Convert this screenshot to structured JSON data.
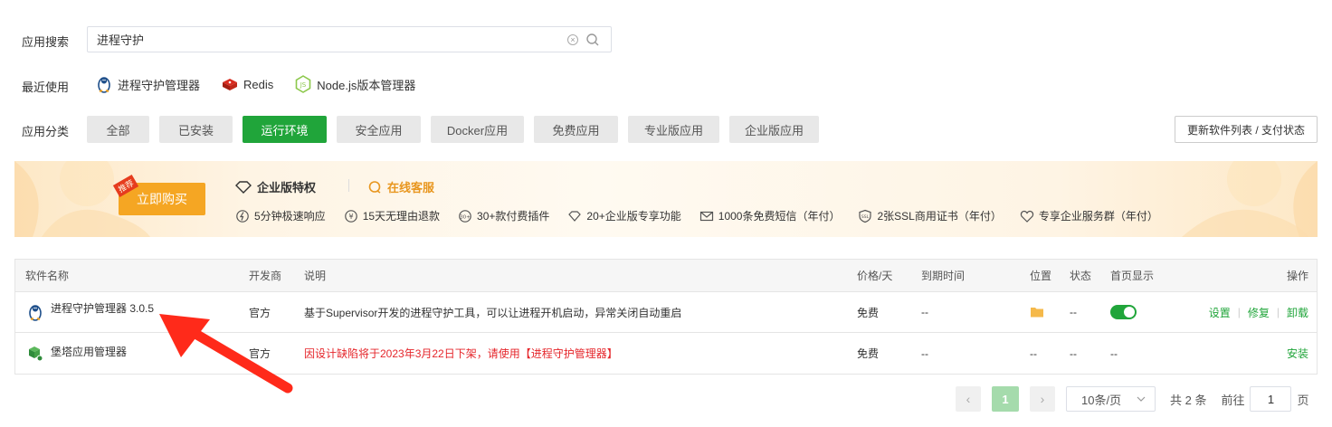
{
  "search": {
    "label": "应用搜索",
    "value": "进程守护"
  },
  "recent": {
    "label": "最近使用",
    "items": [
      {
        "label": "进程守护管理器",
        "icon": "penguin-icon"
      },
      {
        "label": "Redis",
        "icon": "redis-icon"
      },
      {
        "label": "Node.js版本管理器",
        "icon": "nodejs-icon"
      }
    ]
  },
  "categories": {
    "label": "应用分类",
    "items": [
      {
        "label": "全部",
        "active": false
      },
      {
        "label": "已安装",
        "active": false
      },
      {
        "label": "运行环境",
        "active": true
      },
      {
        "label": "安全应用",
        "active": false
      },
      {
        "label": "Docker应用",
        "active": false
      },
      {
        "label": "免费应用",
        "active": false
      },
      {
        "label": "专业版应用",
        "active": false
      },
      {
        "label": "企业版应用",
        "active": false
      }
    ],
    "update_button": "更新软件列表 / 支付状态"
  },
  "banner": {
    "buy_label": "立即购买",
    "buy_tag": "推荐",
    "enterprise_title": "企业版特权",
    "service_title": "在线客服",
    "features": [
      {
        "label": "5分钟极速响应",
        "icon": "lightning-icon"
      },
      {
        "label": "15天无理由退款",
        "icon": "refund-icon"
      },
      {
        "label": "30+款付费插件",
        "icon": "plugin-icon"
      },
      {
        "label": "20+企业版专享功能",
        "icon": "diamond-icon"
      },
      {
        "label": "1000条免费短信（年付）",
        "icon": "mail-icon"
      },
      {
        "label": "2张SSL商用证书（年付）",
        "icon": "ssl-icon"
      },
      {
        "label": "专享企业服务群（年付）",
        "icon": "heart-icon"
      }
    ]
  },
  "table": {
    "headers": {
      "name": "软件名称",
      "developer": "开发商",
      "desc": "说明",
      "price": "价格/天",
      "expire": "到期时间",
      "location": "位置",
      "status": "状态",
      "homepage": "首页显示",
      "actions": "操作"
    },
    "rows": [
      {
        "name": "进程守护管理器 3.0.5",
        "icon": "penguin-icon",
        "developer": "官方",
        "desc": "基于Supervisor开发的进程守护工具，可以让进程开机启动，异常关闭自动重启",
        "price": "免费",
        "expire": "--",
        "status": "--",
        "actions": [
          "设置",
          "修复",
          "卸载"
        ]
      },
      {
        "name": "堡塔应用管理器",
        "icon": "cube-icon",
        "developer": "官方",
        "desc": "因设计缺陷将于2023年3月22日下架，请使用【进程守护管理器】",
        "price": "免费",
        "expire": "--",
        "location": "--",
        "status": "--",
        "homepage": "--",
        "actions": [
          "安装"
        ]
      }
    ]
  },
  "pager": {
    "prev": "‹",
    "page": "1",
    "next": "›",
    "page_size": "10条/页",
    "total": "共 2 条",
    "goto_label": "前往",
    "goto_value": "1",
    "goto_suffix": "页"
  },
  "colors": {
    "accent": "#20a53a",
    "warning": "#f5a623",
    "danger": "#e5262b"
  }
}
